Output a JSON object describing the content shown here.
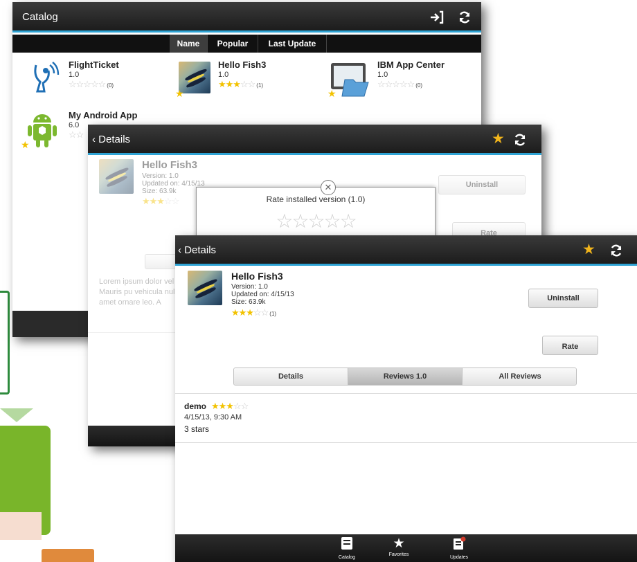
{
  "colors": {
    "accent": "#2ea3d4",
    "star_on": "#f2c200",
    "star_off": "#c8c8c8",
    "favorite_star": "#f2b51c"
  },
  "catalog": {
    "title": "Catalog",
    "tabs": [
      {
        "label": "Name",
        "active": true
      },
      {
        "label": "Popular",
        "active": false
      },
      {
        "label": "Last Update",
        "active": false
      }
    ],
    "apps": [
      {
        "name": "FlightTicket",
        "version": "1.0",
        "rating": 0,
        "count": "(0)",
        "icon": "flight-ticket-icon"
      },
      {
        "name": "Hello Fish3",
        "version": "1.0",
        "rating": 3,
        "count": "(1)",
        "icon": "fish-thumbnail"
      },
      {
        "name": "IBM App Center",
        "version": "1.0",
        "rating": 0,
        "count": "(0)",
        "icon": "tablet-folder-icon"
      },
      {
        "name": "My Android App",
        "version": "6.0",
        "rating": 0,
        "count": "",
        "icon": "android-icon"
      }
    ],
    "icons": {
      "login": "login-icon",
      "refresh": "refresh-icon"
    }
  },
  "details_back": {
    "title": "Details",
    "app_name": "Hello Fish3",
    "version": "Version: 1.0",
    "updated": "Updated on: 4/15/13",
    "size": "Size: 63.9k",
    "rating": 3,
    "uninstall_label": "Uninstall",
    "rate_label": "Rate",
    "dialog_title": "Rate installed version (1.0)",
    "dialog_rating": 0,
    "lorem": "Lorem ipsum dolor vel arcu. Mauris pu vehicula nulla sed amet ornare leo. A"
  },
  "details_front": {
    "title": "Details",
    "app_name": "Hello Fish3",
    "version": "Version: 1.0",
    "updated": "Updated on: 4/15/13",
    "size": "Size: 63.9k",
    "rating": 3,
    "rating_count": "(1)",
    "uninstall_label": "Uninstall",
    "rate_label": "Rate",
    "tabs": [
      {
        "label": "Details",
        "active": false
      },
      {
        "label": "Reviews 1.0",
        "active": true
      },
      {
        "label": "All Reviews",
        "active": false
      }
    ],
    "review": {
      "author": "demo",
      "rating": 3,
      "date": "4/15/13, 9:30 AM",
      "text": "3 stars"
    },
    "tabbar": [
      {
        "label": "Catalog",
        "icon": "catalog-icon"
      },
      {
        "label": "Favorites",
        "icon": "favorites-star-icon"
      },
      {
        "label": "Updates",
        "icon": "updates-icon"
      }
    ]
  }
}
